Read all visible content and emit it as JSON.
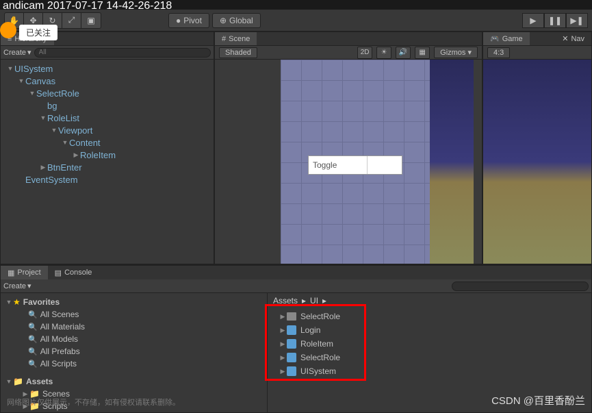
{
  "titlebar": "andicam 2017-07-17 14-42-26-218",
  "follow_badge": "已关注",
  "toolbar": {
    "pivot": "Pivot",
    "global": "Global"
  },
  "hierarchy": {
    "tab": "Hierarchy",
    "create": "Create",
    "search_placeholder": "All",
    "tree": [
      {
        "label": "UISystem",
        "indent": 0,
        "arrow": "▼"
      },
      {
        "label": "Canvas",
        "indent": 1,
        "arrow": "▼"
      },
      {
        "label": "SelectRole",
        "indent": 2,
        "arrow": "▼"
      },
      {
        "label": "bg",
        "indent": 3,
        "arrow": ""
      },
      {
        "label": "RoleList",
        "indent": 3,
        "arrow": "▼"
      },
      {
        "label": "Viewport",
        "indent": 4,
        "arrow": "▼"
      },
      {
        "label": "Content",
        "indent": 5,
        "arrow": "▼"
      },
      {
        "label": "RoleItem",
        "indent": 6,
        "arrow": "▶"
      },
      {
        "label": "BtnEnter",
        "indent": 3,
        "arrow": "▶"
      },
      {
        "label": "EventSystem",
        "indent": 1,
        "arrow": ""
      }
    ]
  },
  "scene": {
    "tab": "Scene",
    "shaded": "Shaded",
    "mode_2d": "2D",
    "gizmos": "Gizmos",
    "toggle_label": "Toggle"
  },
  "game": {
    "tab": "Game",
    "nav_tab": "Nav",
    "aspect": "4:3"
  },
  "project": {
    "tab_project": "Project",
    "tab_console": "Console",
    "create": "Create",
    "favorites": {
      "label": "Favorites",
      "items": [
        "All Scenes",
        "All Materials",
        "All Models",
        "All Prefabs",
        "All Scripts"
      ]
    },
    "assets_root": "Assets",
    "assets_children": [
      "Scenes",
      "Scripts"
    ],
    "breadcrumb": [
      "Assets",
      "UI"
    ],
    "folder_item": "SelectRole",
    "prefabs": [
      "Login",
      "RoleItem",
      "SelectRole",
      "UISystem"
    ]
  },
  "watermark": "CSDN @百里香酚兰",
  "footer": "网络图片仅供展示，不存储，如有侵权请联系删除。"
}
